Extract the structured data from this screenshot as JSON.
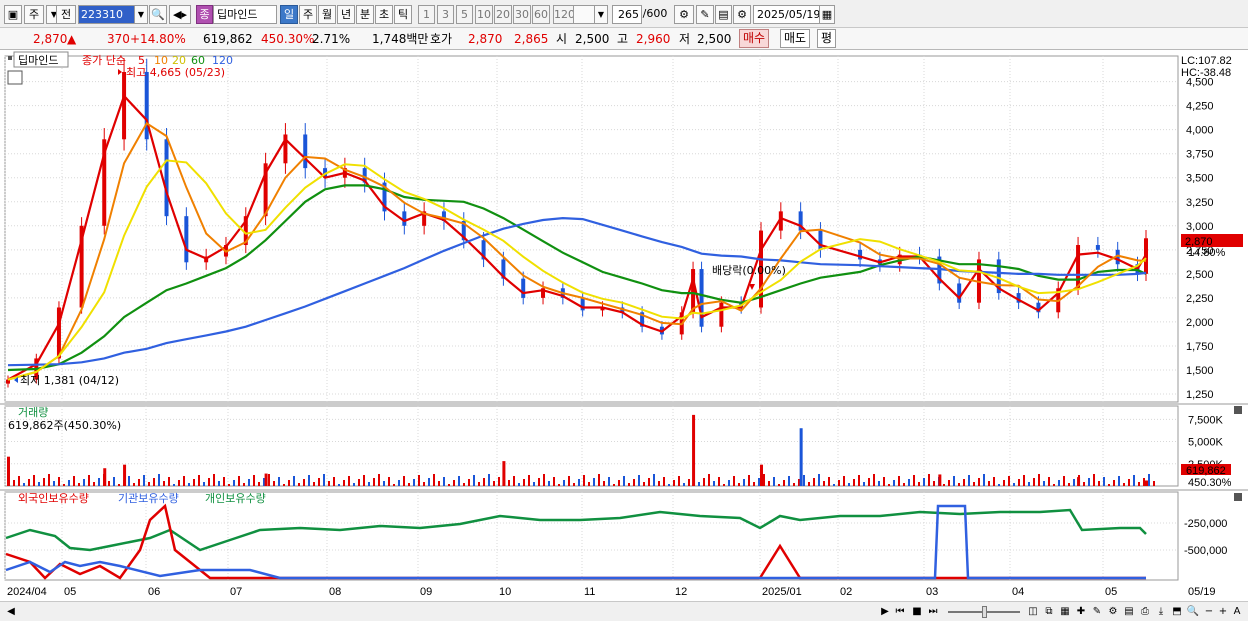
{
  "toolbar": {
    "market_label": "주",
    "prev_label": "전",
    "stock_code": "223310",
    "stock_badge": "종",
    "stock_name": "딥마인드",
    "periods": [
      "일",
      "주",
      "월",
      "년",
      "분",
      "초",
      "틱"
    ],
    "active_period": "일",
    "intervals": [
      "1",
      "3",
      "5",
      "10",
      "20",
      "30",
      "60",
      "120"
    ],
    "count": "265",
    "count_total": "/600",
    "date": "2025/05/19"
  },
  "quote": {
    "price": "2,870",
    "direction": "▲",
    "change": "370",
    "change_pct": "+14.80%",
    "volume": "619,862",
    "volume_ratio": "450.30%",
    "turnover": "2.71%",
    "amount": "1,748백만",
    "ask_label": "호가",
    "ask_price": "2,870",
    "bid_price": "2,865",
    "open_label": "시",
    "open": "2,500",
    "high_label": "고",
    "high": "2,960",
    "low_label": "저",
    "low": "2,500",
    "buy_label": "매수",
    "sell_label": "매도",
    "eval_label": "평"
  },
  "price_panel": {
    "title": "딥마인드",
    "ma_label": "종가 단순",
    "ma_periods": [
      "5",
      "10",
      "20",
      "60",
      "120"
    ],
    "ma_colors": [
      "#e00000",
      "#f08000",
      "#f0e000",
      "#109010",
      "#3060e0"
    ],
    "high_note": "최고 4,665 (05/23)",
    "low_note": "최저 1,381 (04/12)",
    "dividend_note": "배당락(0.00%)",
    "lc": "LC:107.82",
    "hc": "HC:-38.48",
    "last_price": "2,870",
    "last_pct": "14.80%",
    "y_ticks": [
      "4,500",
      "4,250",
      "4,000",
      "3,750",
      "3,500",
      "3,250",
      "3,000",
      "2,750",
      "2,500",
      "2,250",
      "2,000",
      "1,750",
      "1,500",
      "1,250"
    ]
  },
  "volume_panel": {
    "title": "거래량",
    "value_label": "619,862주(450.30%)",
    "y_ticks": [
      "7,500K",
      "5,000K",
      "2,500K"
    ],
    "last_value": "619,862",
    "last_pct": "450.30%"
  },
  "holdings_panel": {
    "series": [
      {
        "name": "외국인보유수량",
        "color": "#e00000"
      },
      {
        "name": "기관보유수량",
        "color": "#3060e0"
      },
      {
        "name": "개인보유수량",
        "color": "#109040"
      }
    ],
    "y_ticks": [
      "-250,000",
      "-500,000"
    ]
  },
  "x_axis": {
    "labels": [
      "2024/04",
      "05",
      "06",
      "07",
      "08",
      "09",
      "10",
      "11",
      "12",
      "2025/01",
      "02",
      "03",
      "04",
      "05"
    ],
    "current_date": "05/19"
  },
  "chart_data": {
    "type": "candlestick",
    "title": "딥마인드",
    "ylim": [
      1250,
      4600
    ],
    "ohlc": [
      {
        "date": "2024-04-12",
        "close": 1400
      },
      {
        "date": "2024-04-22",
        "close": 1620
      },
      {
        "date": "2024-04-30",
        "close": 2150
      },
      {
        "date": "2024-05-08",
        "close": 3000
      },
      {
        "date": "2024-05-16",
        "close": 3900
      },
      {
        "date": "2024-05-23",
        "close": 4600
      },
      {
        "date": "2024-05-31",
        "close": 3900
      },
      {
        "date": "2024-06-07",
        "close": 3100
      },
      {
        "date": "2024-06-14",
        "close": 2620
      },
      {
        "date": "2024-06-21",
        "close": 2680
      },
      {
        "date": "2024-06-28",
        "close": 2800
      },
      {
        "date": "2024-07-05",
        "close": 3100
      },
      {
        "date": "2024-07-12",
        "close": 3650
      },
      {
        "date": "2024-07-19",
        "close": 3950
      },
      {
        "date": "2024-07-26",
        "close": 3600
      },
      {
        "date": "2024-08-02",
        "close": 3500
      },
      {
        "date": "2024-08-09",
        "close": 3600
      },
      {
        "date": "2024-08-16",
        "close": 3450
      },
      {
        "date": "2024-08-23",
        "close": 3150
      },
      {
        "date": "2024-08-30",
        "close": 3000
      },
      {
        "date": "2024-09-06",
        "close": 3150
      },
      {
        "date": "2024-09-13",
        "close": 3050
      },
      {
        "date": "2024-09-20",
        "close": 2850
      },
      {
        "date": "2024-09-27",
        "close": 2650
      },
      {
        "date": "2024-10-04",
        "close": 2450
      },
      {
        "date": "2024-10-11",
        "close": 2250
      },
      {
        "date": "2024-10-18",
        "close": 2350
      },
      {
        "date": "2024-10-25",
        "close": 2250
      },
      {
        "date": "2024-11-01",
        "close": 2120
      },
      {
        "date": "2024-11-08",
        "close": 2150
      },
      {
        "date": "2024-11-15",
        "close": 2100
      },
      {
        "date": "2024-11-22",
        "close": 1950
      },
      {
        "date": "2024-11-29",
        "close": 1870
      },
      {
        "date": "2024-12-06",
        "close": 2100
      },
      {
        "date": "2024-12-10",
        "close": 2550
      },
      {
        "date": "2024-12-13",
        "close": 1950
      },
      {
        "date": "2024-12-20",
        "close": 2200
      },
      {
        "date": "2024-12-27",
        "close": 2150
      },
      {
        "date": "2025-01-03",
        "close": 2950
      },
      {
        "date": "2025-01-10",
        "close": 3150
      },
      {
        "date": "2025-01-17",
        "close": 2950
      },
      {
        "date": "2025-01-24",
        "close": 2750
      },
      {
        "date": "2025-02-07",
        "close": 2650
      },
      {
        "date": "2025-02-14",
        "close": 2600
      },
      {
        "date": "2025-02-21",
        "close": 2700
      },
      {
        "date": "2025-02-28",
        "close": 2680
      },
      {
        "date": "2025-03-07",
        "close": 2400
      },
      {
        "date": "2025-03-14",
        "close": 2200
      },
      {
        "date": "2025-03-21",
        "close": 2650
      },
      {
        "date": "2025-03-28",
        "close": 2300
      },
      {
        "date": "2025-04-04",
        "close": 2200
      },
      {
        "date": "2025-04-11",
        "close": 2100
      },
      {
        "date": "2025-04-18",
        "close": 2350
      },
      {
        "date": "2025-04-25",
        "close": 2800
      },
      {
        "date": "2025-05-02",
        "close": 2750
      },
      {
        "date": "2025-05-09",
        "close": 2600
      },
      {
        "date": "2025-05-16",
        "close": 2500
      },
      {
        "date": "2025-05-19",
        "close": 2870
      }
    ],
    "moving_averages": [
      {
        "name": "5",
        "values": [
          1400,
          1560,
          1980,
          2850,
          3750,
          4350,
          4100,
          3350,
          2750,
          2660,
          2780,
          3050,
          3550,
          3900,
          3700,
          3500,
          3550,
          3470,
          3200,
          3050,
          3130,
          3060,
          2880,
          2680,
          2470,
          2300,
          2330,
          2270,
          2150,
          2150,
          2100,
          1970,
          1900,
          2060,
          2450,
          2050,
          2150,
          2150,
          2750,
          3080,
          3000,
          2800,
          2680,
          2620,
          2680,
          2680,
          2450,
          2250,
          2550,
          2350,
          2230,
          2120,
          2300,
          2700,
          2720,
          2650,
          2550,
          2700
        ]
      },
      {
        "name": "60",
        "values": [
          1500,
          1510,
          1560,
          1680,
          1850,
          2050,
          2200,
          2330,
          2400,
          2480,
          2560,
          2680,
          2850,
          3050,
          3250,
          3380,
          3420,
          3420,
          3380,
          3300,
          3270,
          3260,
          3250,
          3180,
          3080,
          2960,
          2840,
          2720,
          2620,
          2520,
          2460,
          2400,
          2330,
          2300,
          2300,
          2280,
          2230,
          2200,
          2260,
          2330,
          2400,
          2460,
          2520,
          2590,
          2640,
          2680,
          2640,
          2600,
          2600,
          2580,
          2550,
          2480,
          2440,
          2440,
          2520,
          2540,
          2540,
          2500
        ]
      },
      {
        "name": "120",
        "values": [
          1550,
          1555,
          1560,
          1580,
          1620,
          1680,
          1720,
          1780,
          1820,
          1860,
          1900,
          1950,
          2020,
          2090,
          2160,
          2240,
          2320,
          2400,
          2480,
          2560,
          2650,
          2740,
          2820,
          2900,
          2970,
          3020,
          3060,
          3080,
          3070,
          3010,
          2950,
          2890,
          2830,
          2780,
          2740,
          2710,
          2690,
          2680,
          2650,
          2640,
          2620,
          2600,
          2590,
          2580,
          2570,
          2560,
          2550,
          2530,
          2520,
          2510,
          2500,
          2500,
          2490,
          2490,
          2490,
          2490,
          2500,
          2510
        ]
      }
    ],
    "volume": [
      {
        "date": "2024-04-12",
        "value": 3300
      },
      {
        "date": "2024-05-16",
        "value": 2000
      },
      {
        "date": "2024-05-23",
        "value": 2400
      },
      {
        "date": "2024-07-12",
        "value": 1400
      },
      {
        "date": "2024-10-04",
        "value": 2800
      },
      {
        "date": "2024-12-10",
        "value": 8000
      },
      {
        "date": "2025-01-03",
        "value": 2400
      },
      {
        "date": "2025-01-17",
        "value": 6500
      },
      {
        "date": "2025-03-07",
        "value": 1300
      },
      {
        "date": "2025-04-25",
        "value": 1000
      },
      {
        "date": "2025-05-19",
        "value": 620
      }
    ]
  }
}
